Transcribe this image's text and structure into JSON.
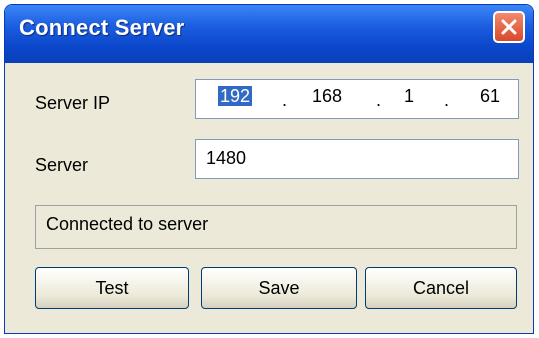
{
  "window": {
    "title": "Connect Server"
  },
  "form": {
    "server_ip_label": "Server IP",
    "ip": {
      "octet1": "192",
      "octet2": "168",
      "octet3": "1",
      "octet4": "61",
      "separator": "."
    },
    "server_label": "Server",
    "server_value": "1480"
  },
  "status": {
    "text": "Connected to server"
  },
  "buttons": {
    "test": "Test",
    "save": "Save",
    "cancel": "Cancel"
  },
  "colors": {
    "titlebar": "#0b48cc",
    "close": "#d9482b",
    "selection": "#316ac5",
    "dialog_bg": "#ece9d8"
  },
  "icons": {
    "close": "close-icon"
  }
}
